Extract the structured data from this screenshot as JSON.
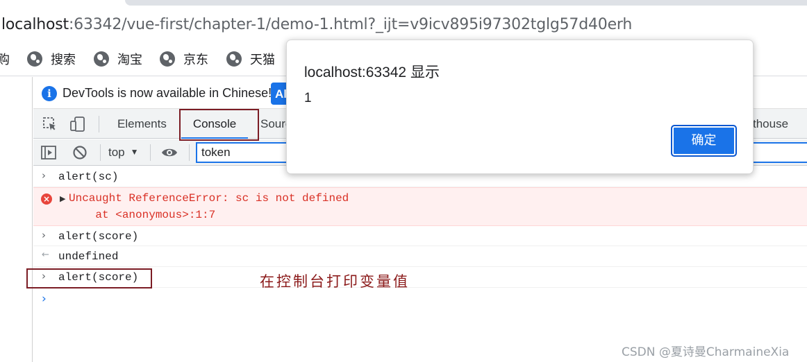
{
  "browser": {
    "url_host": "localhost",
    "url_rest": ":63342/vue-first/chapter-1/demo-1.html?_ijt=v9icv895i97302tglg57d40erh",
    "bookmarks": [
      {
        "label": "购",
        "icon": "globe-icon"
      },
      {
        "label": "搜索",
        "icon": "globe-icon"
      },
      {
        "label": "淘宝",
        "icon": "globe-icon"
      },
      {
        "label": "京东",
        "icon": "globe-icon"
      },
      {
        "label": "天猫",
        "icon": "globe-icon"
      }
    ]
  },
  "devtools": {
    "infobar": {
      "icon": "info-icon",
      "text": "DevTools is now available in Chinese!",
      "button_label": "Al"
    },
    "tabs": [
      {
        "label": "Elements"
      },
      {
        "label": "Console",
        "active": true
      },
      {
        "label": "Sourc"
      },
      {
        "label": "thouse"
      }
    ],
    "toolbar": {
      "context_label": "top",
      "filter_value": "token"
    },
    "console": {
      "lines": [
        {
          "kind": "input",
          "text": "alert(sc)"
        },
        {
          "kind": "error",
          "text": "Uncaught ReferenceError: sc is not defined",
          "detail": "    at <anonymous>:1:7"
        },
        {
          "kind": "input",
          "text": "alert(score)"
        },
        {
          "kind": "result",
          "text": "undefined"
        },
        {
          "kind": "input",
          "text": "alert(score)"
        }
      ]
    }
  },
  "dialog": {
    "title": "localhost:63342 显示",
    "message": "1",
    "ok_label": "确定"
  },
  "annotation": {
    "text": "在控制台打印变量值",
    "color": "#7b1c24"
  },
  "watermark": "CSDN @夏诗曼CharmaineXia",
  "colors": {
    "accent": "#1a73e8",
    "error": "#d93025",
    "error_bg": "#fff0f0"
  }
}
